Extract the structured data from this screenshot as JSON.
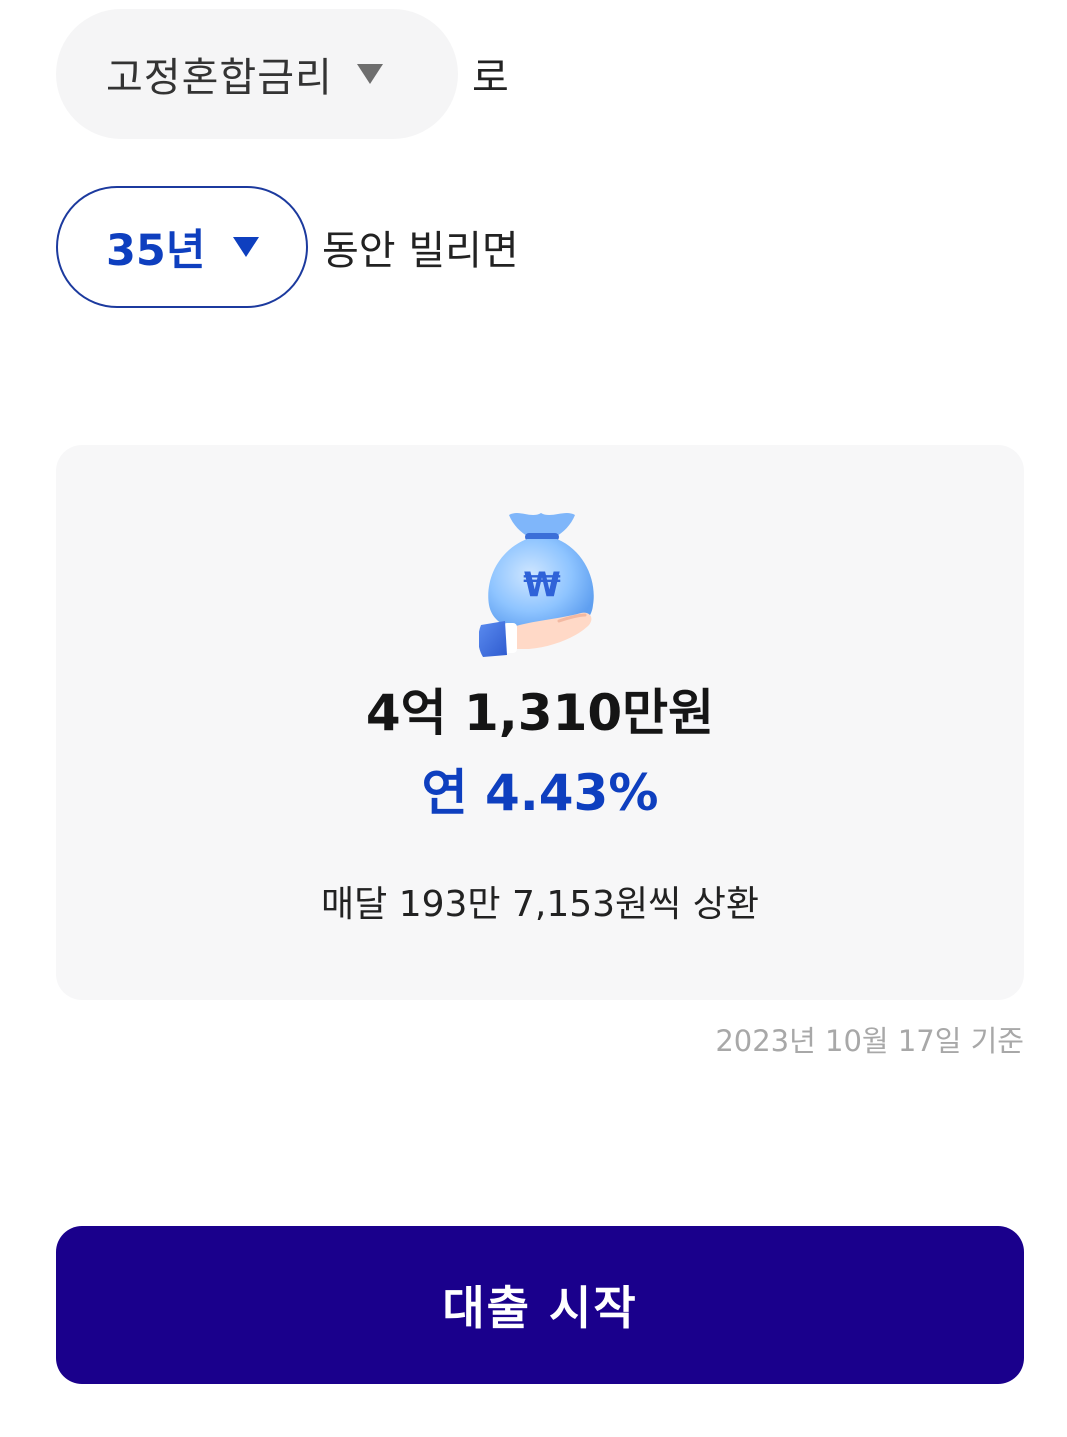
{
  "rate_type": {
    "selected": "고정혼합금리",
    "suffix": "로"
  },
  "loan_term": {
    "selected": "35년",
    "suffix": "동안 빌리면"
  },
  "result": {
    "amount": "4억 1,310만원",
    "rate": "연 4.43%",
    "monthly": "매달 193만 7,153원씩 상환"
  },
  "basis_date": "2023년 10월 17일 기준",
  "cta": {
    "label": "대출 시작"
  },
  "colors": {
    "accent_blue": "#0e3fbf",
    "cta_background": "#1a008c",
    "card_background": "#f7f7f8"
  },
  "icons": {
    "dropdown": "caret-down-icon",
    "illustration": "money-bag-hand-icon"
  }
}
